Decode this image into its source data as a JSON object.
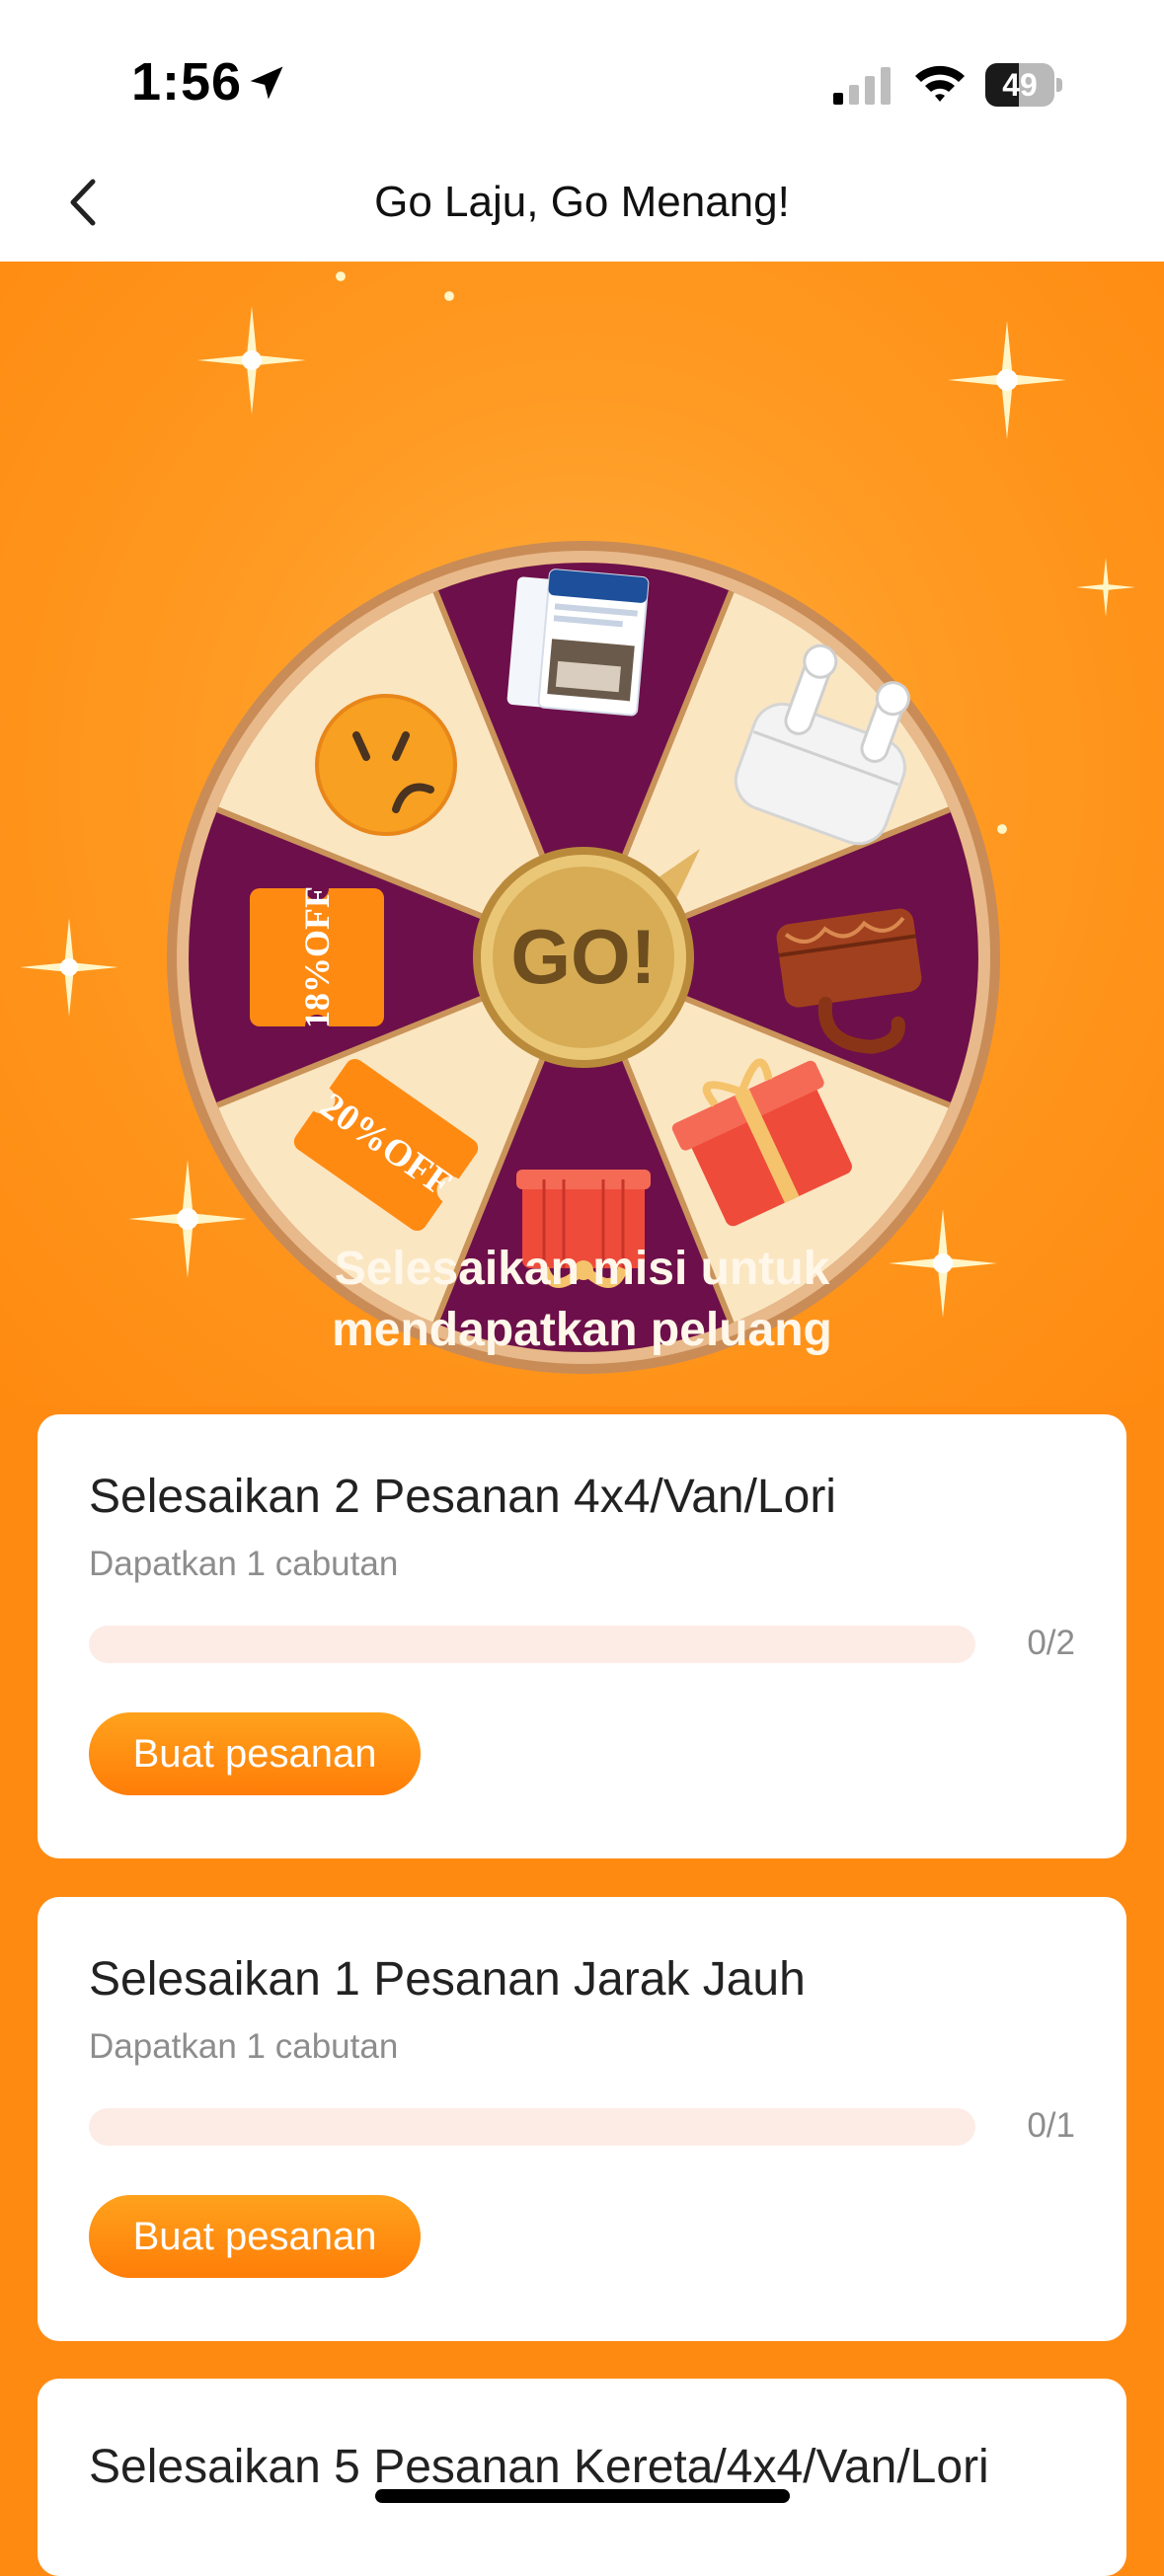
{
  "status_bar": {
    "time": "1:56",
    "battery": "49",
    "battery_level": 0.49,
    "icons": [
      "location-arrow-icon",
      "cellular-signal-icon",
      "wifi-icon",
      "battery-icon"
    ]
  },
  "nav": {
    "title": "Go Laju, Go Menang!",
    "back_icon": "chevron-left-icon"
  },
  "wheel": {
    "center_label": "GO!",
    "segments": [
      {
        "prize": "flight-ticket",
        "badge": ""
      },
      {
        "prize": "wireless-earbuds",
        "badge": ""
      },
      {
        "prize": "handbag",
        "badge": ""
      },
      {
        "prize": "gift-box",
        "badge": ""
      },
      {
        "prize": "gift-box",
        "badge": ""
      },
      {
        "prize": "voucher",
        "badge": "20%OFF"
      },
      {
        "prize": "voucher",
        "badge": "18%OFF"
      },
      {
        "prize": "sad-face",
        "badge": ""
      }
    ],
    "colors": {
      "purple": "#6d0f4a",
      "cream": "#fbe6c2",
      "rim": "#d7a46e",
      "accent": "#ff8a12"
    }
  },
  "missions": {
    "heading_line1": "Selesaikan misi untuk",
    "heading_line2": "mendapatkan peluang",
    "items": [
      {
        "title": "Selesaikan 2 Pesanan 4x4/Van/Lori",
        "subtitle": "Dapatkan 1 cabutan",
        "progress": "0/2",
        "progress_value": 0,
        "button": "Buat pesanan"
      },
      {
        "title": "Selesaikan 1 Pesanan Jarak Jauh",
        "subtitle": "Dapatkan 1 cabutan",
        "progress": "0/1",
        "progress_value": 0,
        "button": "Buat pesanan"
      },
      {
        "title": "Selesaikan 5 Pesanan Kereta/4x4/Van/Lori"
      }
    ]
  }
}
